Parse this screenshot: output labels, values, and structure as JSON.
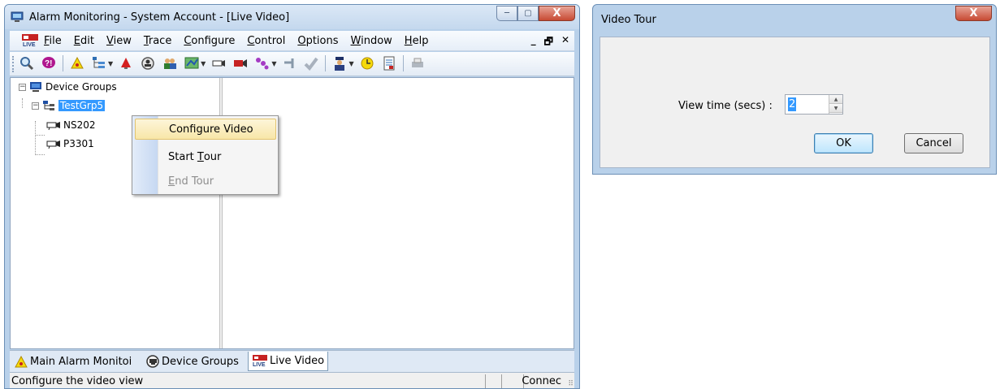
{
  "main_window": {
    "title": "Alarm Monitoring - System Account - [Live Video]",
    "caption_buttons": {
      "minimize": "─",
      "maximize": "▢",
      "close": "X"
    },
    "menu": [
      "File",
      "Edit",
      "View",
      "Trace",
      "Configure",
      "Control",
      "Options",
      "Window",
      "Help"
    ],
    "mdi_controls": {
      "minimize": "_",
      "restore": "🗗",
      "close": "✕"
    },
    "tree": {
      "root": "Device Groups",
      "group": "TestGrp5",
      "devices": [
        "NS202",
        "P3301"
      ]
    },
    "context_menu": {
      "configure_video": "Configure Video",
      "start_tour_pre": "Start ",
      "start_tour_ul": "T",
      "start_tour_post": "our",
      "end_tour_pre": "",
      "end_tour_ul": "E",
      "end_tour_post": "nd Tour"
    },
    "tabs": [
      "Main Alarm Monitoi",
      "Device Groups",
      "Live Video"
    ],
    "status": {
      "text": "Configure the video view",
      "connection": "Connec"
    }
  },
  "dialog": {
    "title": "Video Tour",
    "close": "X",
    "view_time_label": "View time (secs) :",
    "view_time_value": "2",
    "ok_label": "OK",
    "cancel_label": "Cancel"
  },
  "toolbar_icons": [
    "search-icon",
    "help-icon",
    "alarm-bell-icon",
    "tree-icon",
    "red-alarm-icon",
    "badge-icon",
    "users-icon",
    "map-icon",
    "camera-icon",
    "video-camera-icon",
    "trace-icon",
    "door-icon",
    "check-icon",
    "guard-icon",
    "clock-icon",
    "report-icon",
    "print-icon"
  ],
  "colors": {
    "selection": "#3399ff",
    "title_bar": "#c4d8ee",
    "close_button": "#c74a33"
  }
}
